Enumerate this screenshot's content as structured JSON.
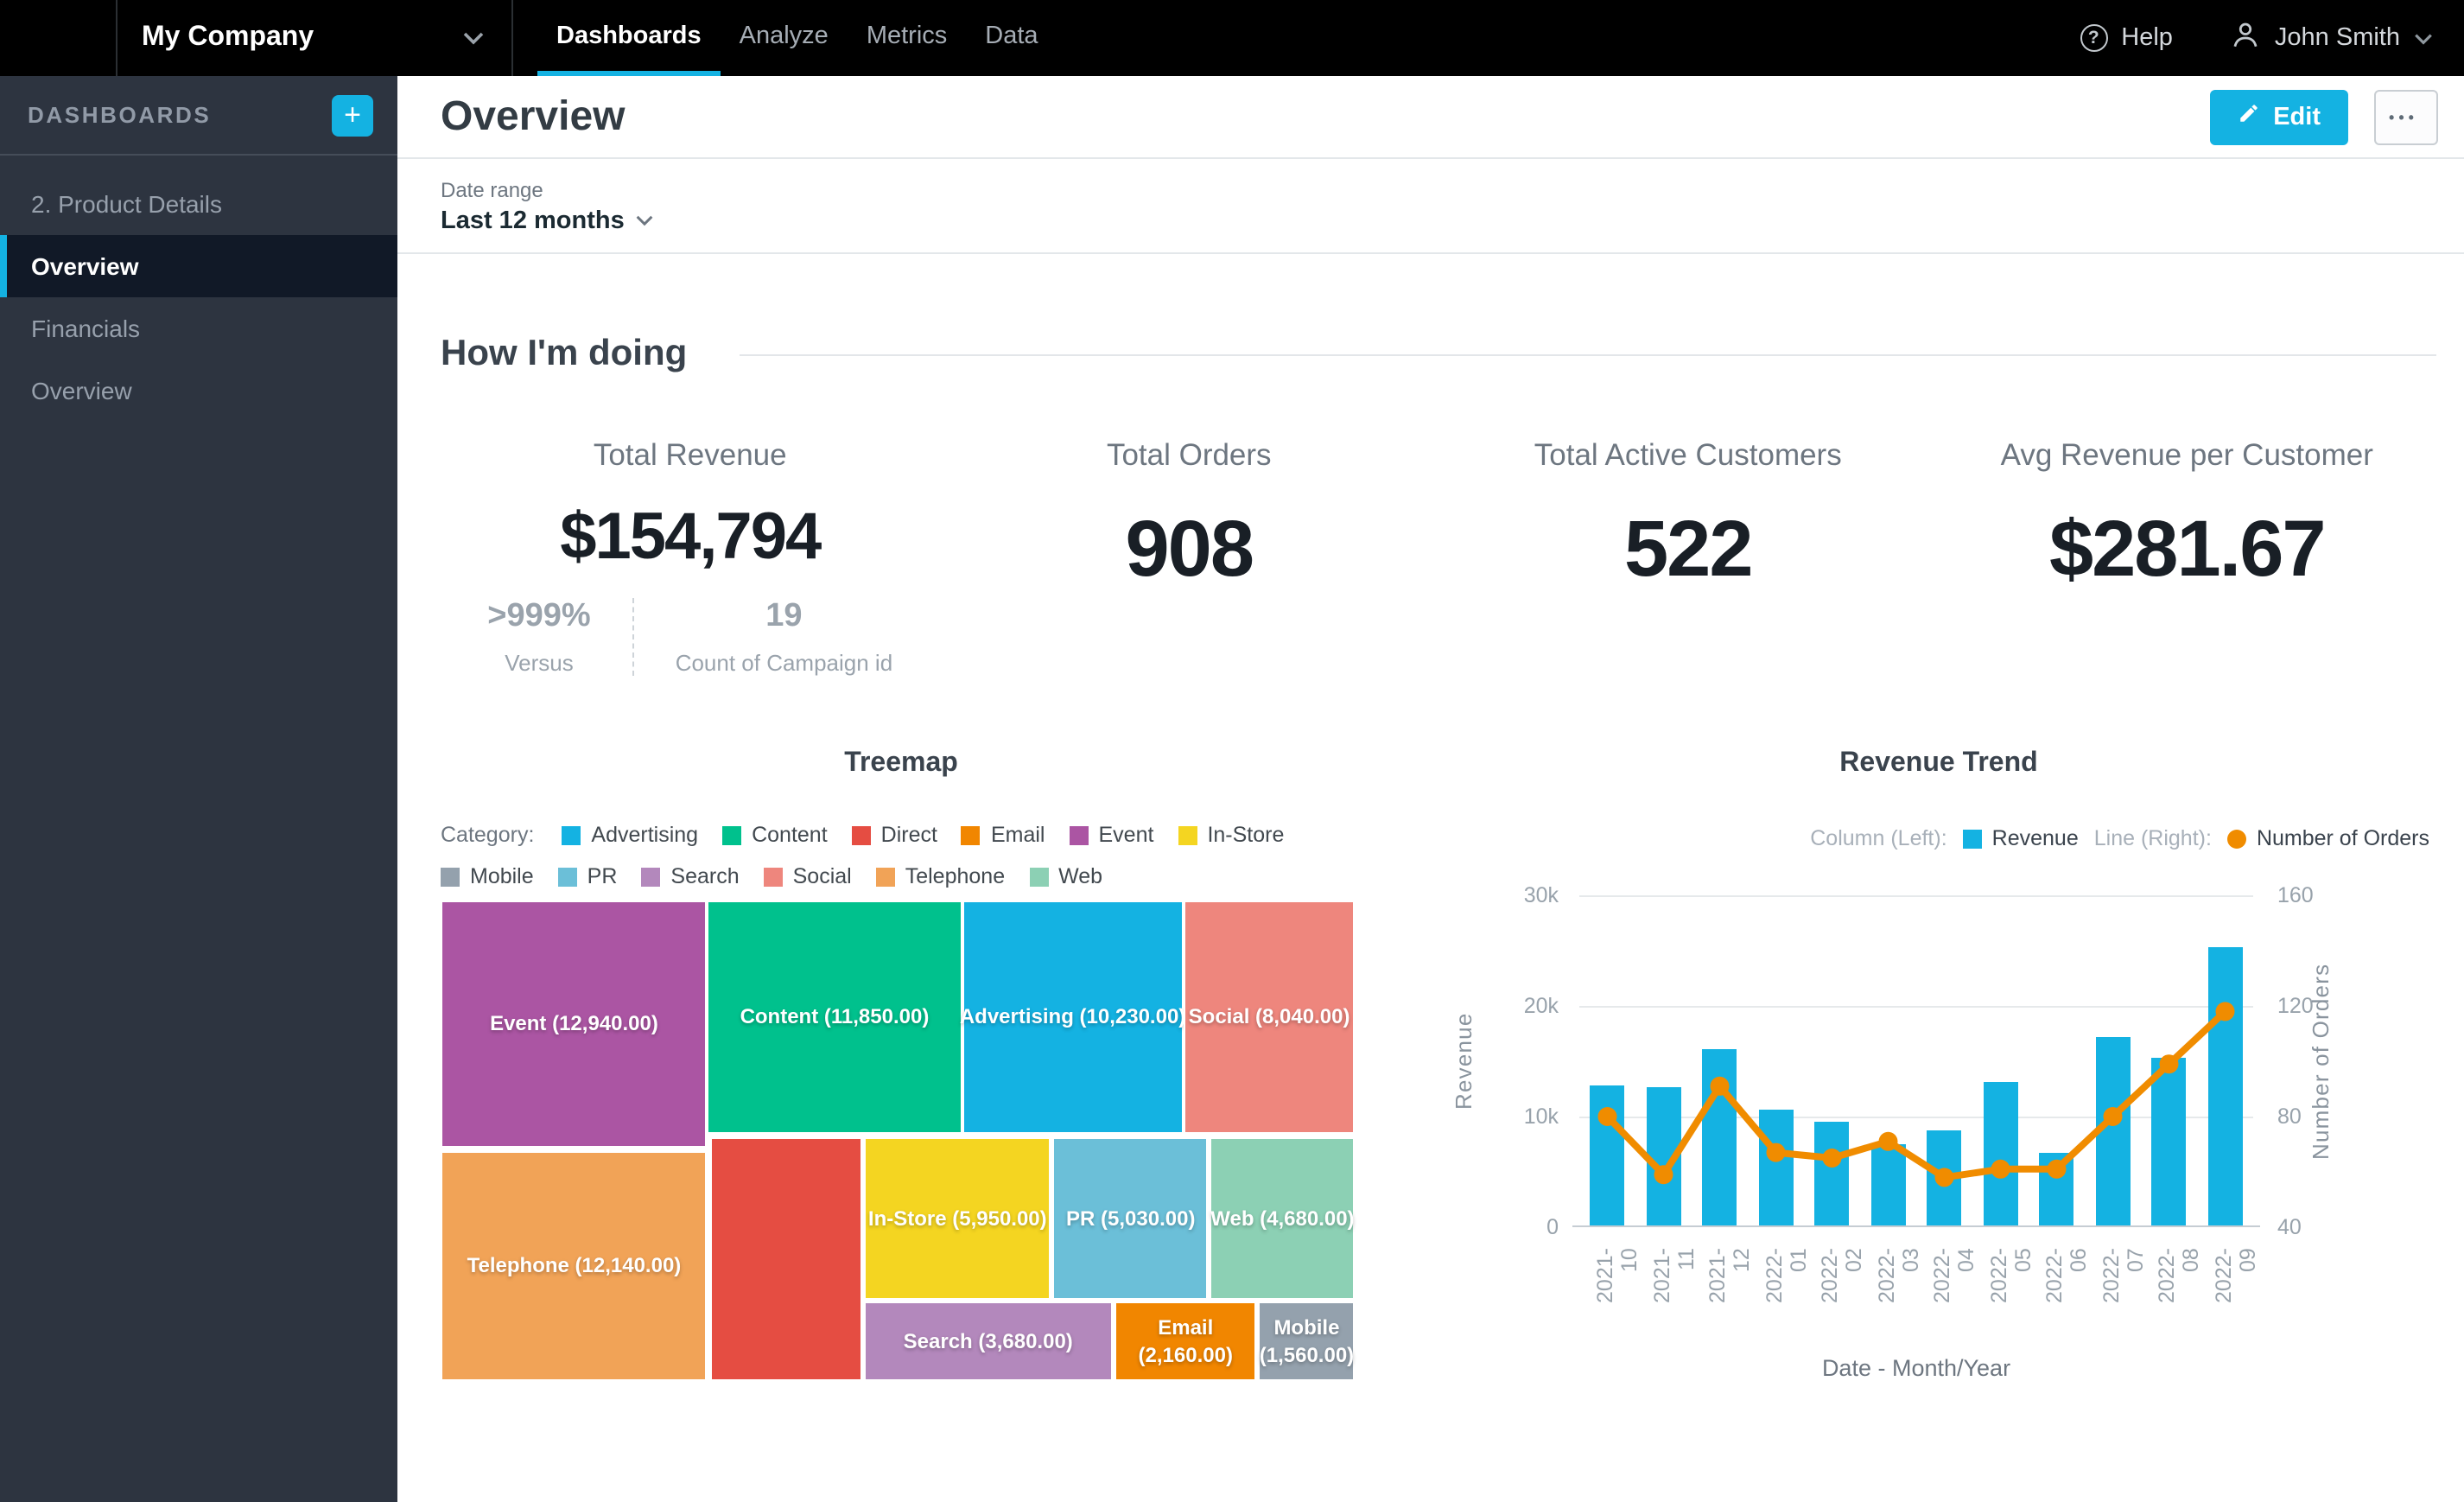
{
  "nav": {
    "workspace": "My Company",
    "tabs": [
      {
        "label": "Dashboards",
        "active": true
      },
      {
        "label": "Analyze",
        "active": false
      },
      {
        "label": "Metrics",
        "active": false
      },
      {
        "label": "Data",
        "active": false
      }
    ],
    "help_label": "Help",
    "user_name": "John Smith"
  },
  "sidebar": {
    "header": "DASHBOARDS",
    "add_label": "+",
    "items": [
      {
        "label": "2. Product Details",
        "active": false
      },
      {
        "label": "Overview",
        "active": true
      },
      {
        "label": "Financials",
        "active": false
      },
      {
        "label": "Overview",
        "active": false
      }
    ]
  },
  "header": {
    "title": "Overview",
    "edit_label": "Edit",
    "more_label": "•••"
  },
  "filter": {
    "label": "Date range",
    "value": "Last 12 months"
  },
  "section": {
    "title": "How I'm doing"
  },
  "kpis": [
    {
      "title": "Total Revenue",
      "value": "$154,794",
      "secondary": [
        {
          "value": ">999%",
          "label": "Versus"
        },
        {
          "value": "19",
          "label": "Count of Campaign id"
        }
      ]
    },
    {
      "title": "Total Orders",
      "value": "908"
    },
    {
      "title": "Total Active Customers",
      "value": "522"
    },
    {
      "title": "Avg Revenue per Customer",
      "value": "$281.67"
    }
  ],
  "colors": {
    "accent": "#14B2E2",
    "bar": "#14B2E2",
    "line": "#F08C00",
    "sidebar_bg": "#2D3440",
    "sidebar_selected_bg": "#111927"
  },
  "chart_data": [
    {
      "type": "treemap",
      "title": "Treemap",
      "legend_label": "Category:",
      "legend": [
        {
          "label": "Advertising",
          "color": "#14B2E2"
        },
        {
          "label": "Content",
          "color": "#00C18D"
        },
        {
          "label": "Direct",
          "color": "#E54D42"
        },
        {
          "label": "Email",
          "color": "#F18600"
        },
        {
          "label": "Event",
          "color": "#AB55A3"
        },
        {
          "label": "In-Store",
          "color": "#F4D521"
        },
        {
          "label": "Mobile",
          "color": "#94A1AD"
        },
        {
          "label": "PR",
          "color": "#6BBFD8"
        },
        {
          "label": "Search",
          "color": "#B388BC"
        },
        {
          "label": "Social",
          "color": "#EE867D"
        },
        {
          "label": "Telephone",
          "color": "#F1A357"
        },
        {
          "label": "Web",
          "color": "#8CD0B4"
        }
      ],
      "tiles": [
        {
          "name": "Event",
          "value": 12940,
          "label": "Event (12,940.00)",
          "color": "#AB55A3",
          "x": 0,
          "y": 0,
          "w": 29.2,
          "h": 51.5,
          "wrap": false
        },
        {
          "name": "Content",
          "value": 11850,
          "label": "Content (11,850.00)",
          "color": "#00C18D",
          "x": 29.2,
          "y": 0,
          "w": 27.8,
          "h": 48.5,
          "wrap": false
        },
        {
          "name": "Advertising",
          "value": 10230,
          "label": "Advertising (10,230.00)",
          "color": "#14B2E2",
          "x": 57.0,
          "y": 0,
          "w": 24.3,
          "h": 48.5,
          "wrap": false
        },
        {
          "name": "Social",
          "value": 8040,
          "label": "Social (8,040.00)",
          "color": "#EE867D",
          "x": 81.3,
          "y": 0,
          "w": 18.7,
          "h": 48.5,
          "wrap": false
        },
        {
          "name": "Telephone",
          "value": 12140,
          "label": "Telephone (12,140.00)",
          "color": "#F1A357",
          "x": 0,
          "y": 52.2,
          "w": 29.2,
          "h": 47.8,
          "wrap": false
        },
        {
          "name": "Direct",
          "value": null,
          "label": "",
          "color": "#E54D42",
          "x": 29.5,
          "y": 49.4,
          "w": 16.6,
          "h": 50.6,
          "wrap": false
        },
        {
          "name": "In-Store",
          "value": 5950,
          "label": "In-Store (5,950.00)",
          "color": "#F4D521",
          "x": 46.3,
          "y": 49.4,
          "w": 20.5,
          "h": 33.7,
          "wrap": false
        },
        {
          "name": "PR",
          "value": 5030,
          "label": "PR (5,030.00)",
          "color": "#6BBFD8",
          "x": 67.0,
          "y": 49.4,
          "w": 17.0,
          "h": 33.7,
          "wrap": false
        },
        {
          "name": "Web",
          "value": 4680,
          "label": "Web (4,680.00)",
          "color": "#8CD0B4",
          "x": 84.2,
          "y": 49.4,
          "w": 15.8,
          "h": 33.7,
          "wrap": false
        },
        {
          "name": "Search",
          "value": 3680,
          "label": "Search (3,680.00)",
          "color": "#B388BC",
          "x": 46.3,
          "y": 83.5,
          "w": 27.2,
          "h": 16.5,
          "wrap": false
        },
        {
          "name": "Email",
          "value": 2160,
          "label": "Email (2,160.00)",
          "color": "#F18600",
          "x": 73.7,
          "y": 83.5,
          "w": 15.6,
          "h": 16.5,
          "wrap": true
        },
        {
          "name": "Mobile",
          "value": 1560,
          "label": "Mobile (1,560.00)",
          "color": "#94A1AD",
          "x": 89.5,
          "y": 83.5,
          "w": 10.5,
          "h": 16.5,
          "wrap": true
        }
      ]
    },
    {
      "type": "bar",
      "title": "Revenue Trend",
      "legend": [
        {
          "prefix": "Column (Left):",
          "series": "Revenue",
          "color": "#14B2E2",
          "marker": "square"
        },
        {
          "prefix": "Line (Right):",
          "series": "Number of Orders",
          "color": "#F08C00",
          "marker": "circle"
        }
      ],
      "categories": [
        "2021-10",
        "2021-11",
        "2021-12",
        "2022-01",
        "2022-02",
        "2022-03",
        "2022-04",
        "2022-05",
        "2022-06",
        "2022-07",
        "2022-08",
        "2022-09"
      ],
      "series": [
        {
          "name": "Revenue",
          "type": "column",
          "axis": "left",
          "color": "#14B2E2",
          "values": [
            12700,
            12500,
            15900,
            10400,
            9400,
            7300,
            8600,
            12900,
            6600,
            17100,
            15200,
            25100
          ]
        },
        {
          "name": "Number of Orders",
          "type": "line",
          "axis": "right",
          "color": "#F08C00",
          "values": [
            80,
            59,
            91,
            67,
            65,
            71,
            58,
            61,
            61,
            80,
            99,
            118
          ]
        }
      ],
      "left_axis": {
        "label": "Revenue",
        "min": 0,
        "max": 30000,
        "ticks": [
          "0",
          "10k",
          "20k",
          "30k"
        ]
      },
      "right_axis": {
        "label": "Number of Orders",
        "min": 40,
        "max": 160,
        "ticks": [
          "40",
          "80",
          "120",
          "160"
        ]
      },
      "xlabel": "Date - Month/Year",
      "grid": true,
      "legend_position": "top-right"
    }
  ]
}
